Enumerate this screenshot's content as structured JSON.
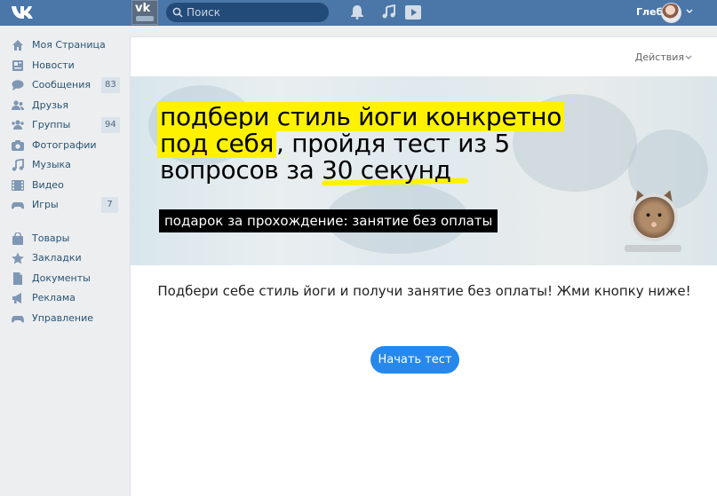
{
  "topbar": {
    "search_placeholder": "Поиск",
    "user_name": "Глеб",
    "group_thumb_text": "vk"
  },
  "sidebar": {
    "items": [
      {
        "label": "Моя Страница",
        "icon": "home-icon",
        "badge": ""
      },
      {
        "label": "Новости",
        "icon": "news-icon",
        "badge": ""
      },
      {
        "label": "Сообщения",
        "icon": "messages-icon",
        "badge": "83"
      },
      {
        "label": "Друзья",
        "icon": "friends-icon",
        "badge": ""
      },
      {
        "label": "Группы",
        "icon": "groups-icon",
        "badge": "94"
      },
      {
        "label": "Фотографии",
        "icon": "photos-icon",
        "badge": ""
      },
      {
        "label": "Музыка",
        "icon": "music-icon",
        "badge": ""
      },
      {
        "label": "Видео",
        "icon": "video-icon",
        "badge": ""
      },
      {
        "label": "Игры",
        "icon": "games-icon",
        "badge": "7"
      }
    ],
    "items2": [
      {
        "label": "Товары",
        "icon": "bag-icon"
      },
      {
        "label": "Закладки",
        "icon": "star-icon"
      },
      {
        "label": "Документы",
        "icon": "document-icon"
      },
      {
        "label": "Реклама",
        "icon": "megaphone-icon"
      },
      {
        "label": "Управление",
        "icon": "gamepad-icon"
      }
    ]
  },
  "panel": {
    "actions_label": "Действия",
    "banner": {
      "line1": "подбери стиль йоги конкретно",
      "line2_mark": "под себя",
      "line2_rest": ", пройдя тест из 5",
      "line3": "вопросов за 30 секунд",
      "gift": "подарок за прохождение: занятие без оплаты"
    },
    "description": "Подбери себе стиль йоги и получи занятие без оплаты! Жми кнопку ниже!",
    "start_button": "Начать тест"
  },
  "colors": {
    "header": "#4a76a8",
    "accent": "#2688eb",
    "highlight": "#fff200",
    "background": "#edeef0"
  }
}
